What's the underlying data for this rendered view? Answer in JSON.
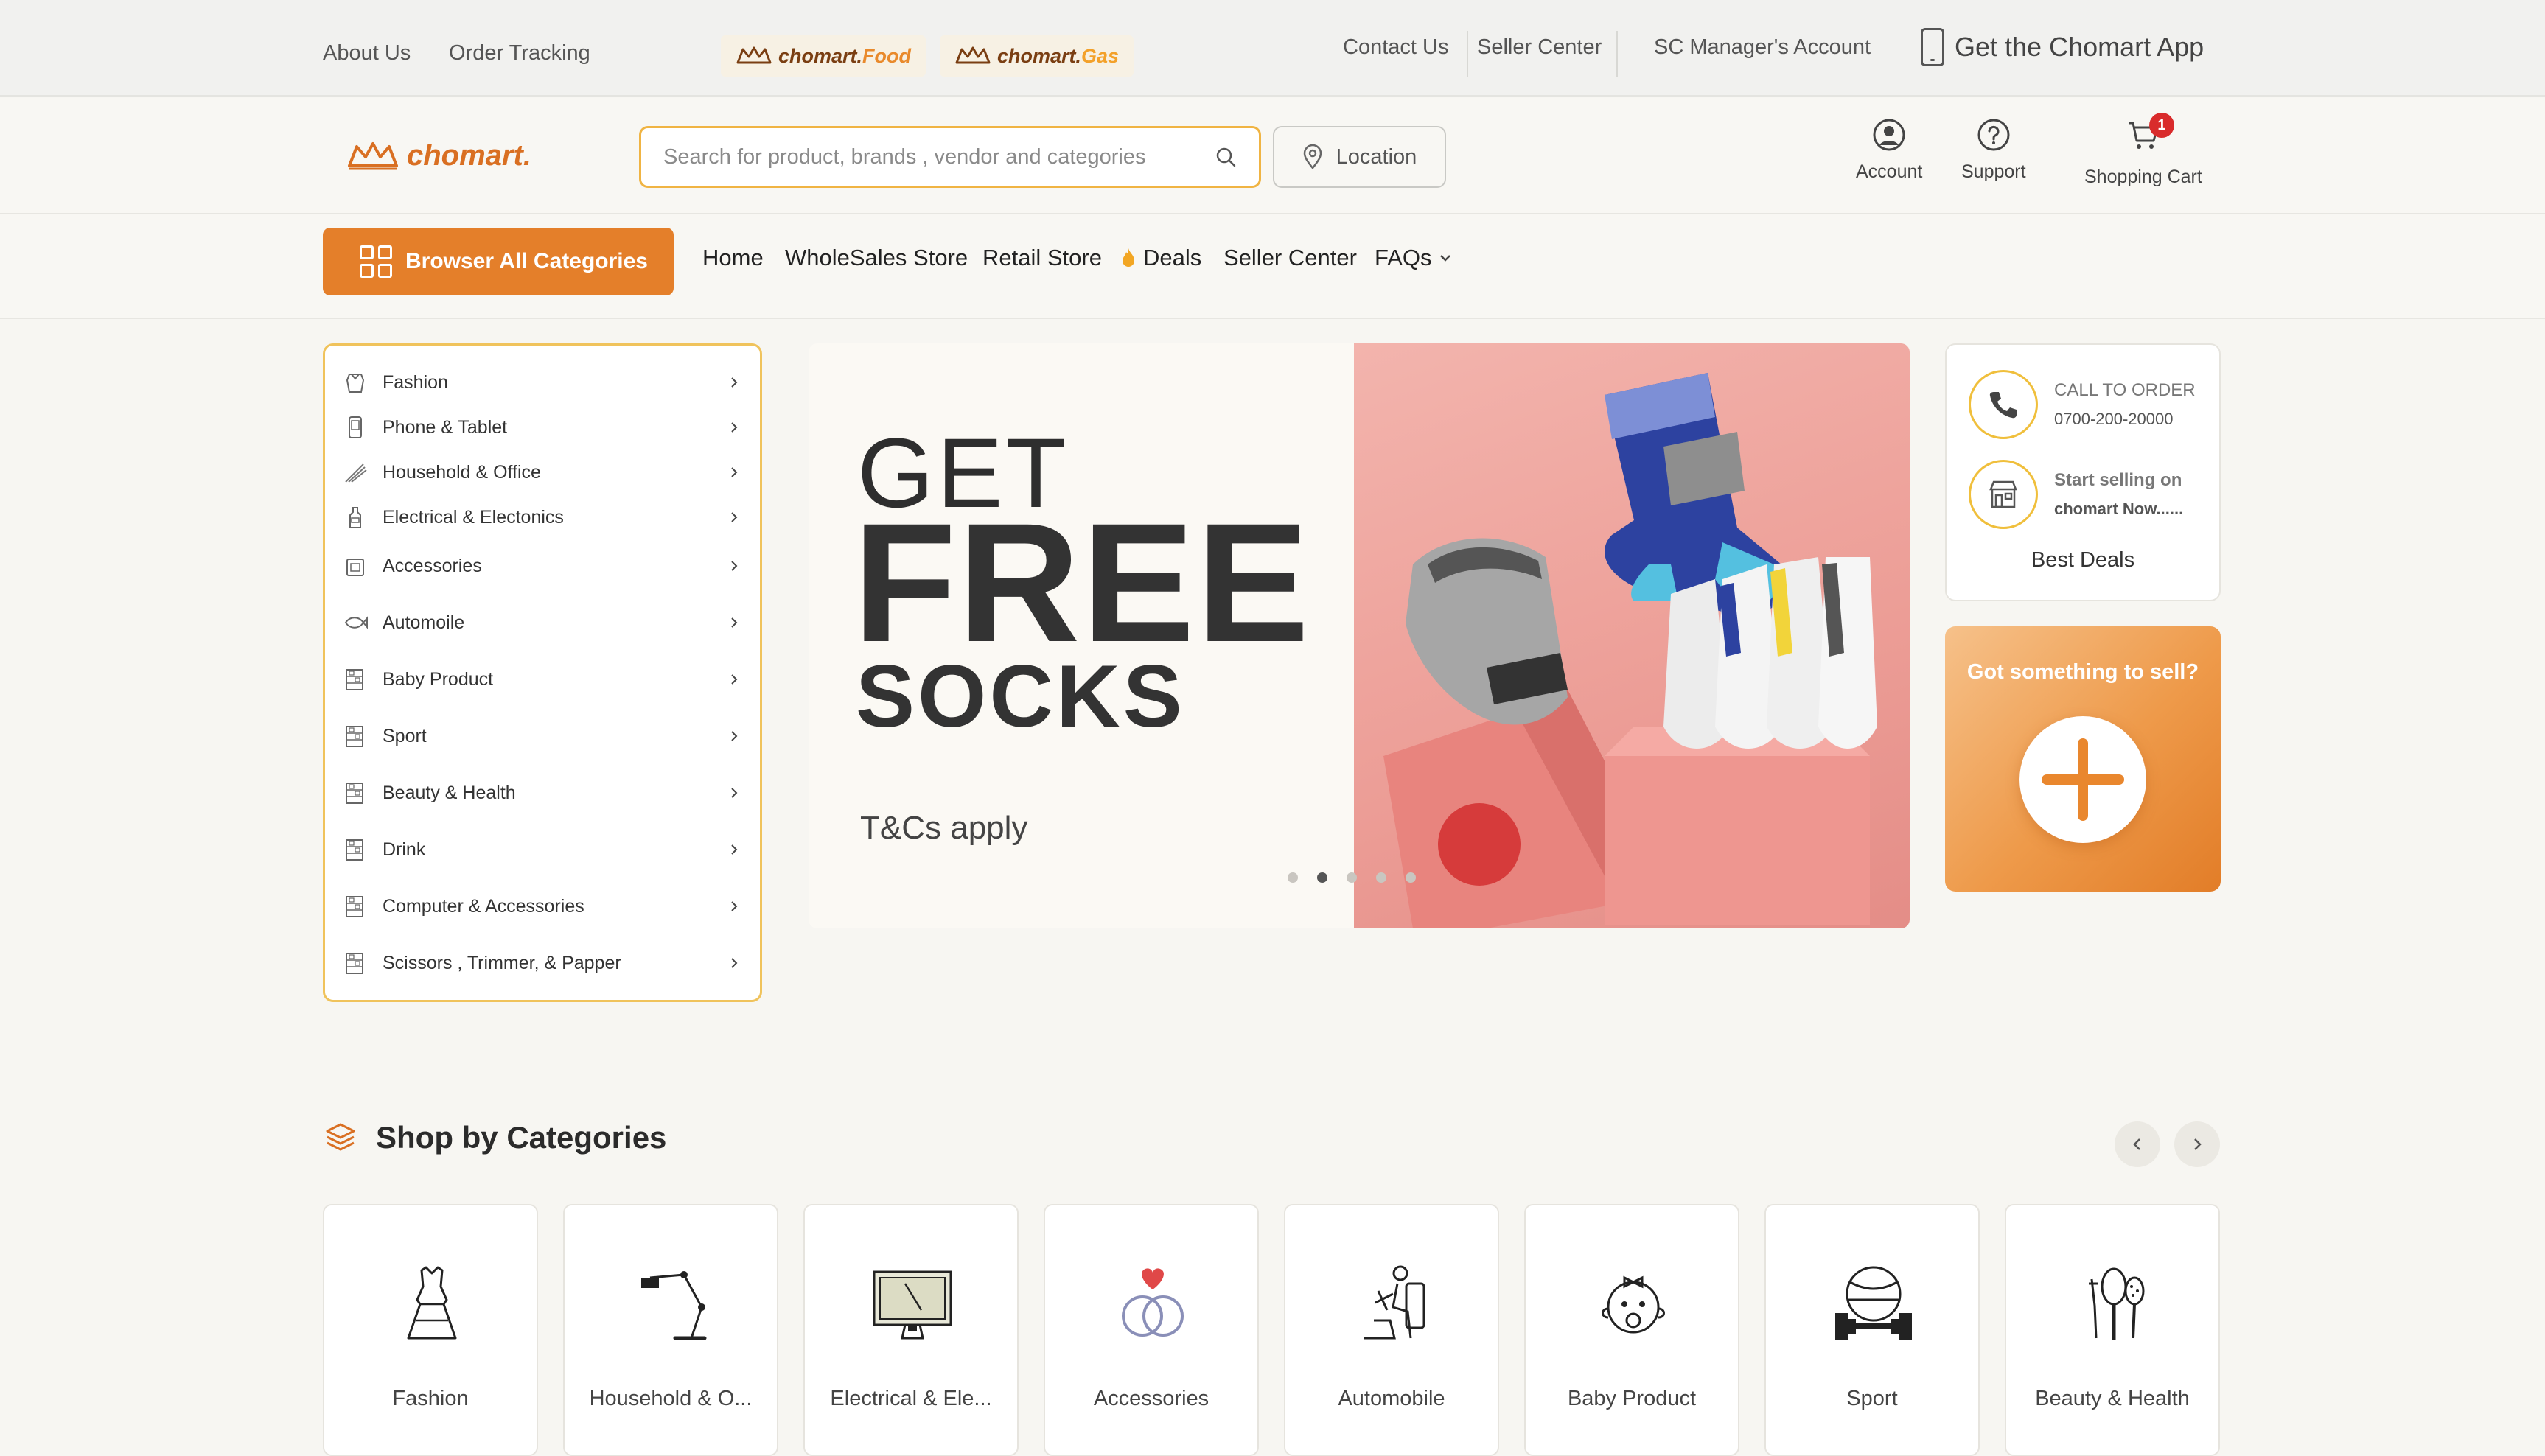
{
  "topbar": {
    "about": "About Us",
    "tracking": "Order Tracking",
    "food_brand": "chomart.",
    "food_suffix": "Food",
    "gas_brand": "chomart.",
    "gas_suffix": "Gas",
    "contact": "Contact Us",
    "seller_center": "Seller Center",
    "manager": "SC Manager's Account",
    "app": "Get the Chomart App"
  },
  "header": {
    "logo": "chomart.",
    "search_placeholder": "Search for product, brands , vendor and categories",
    "location": "Location",
    "account": "Account",
    "support": "Support",
    "cart": "Shopping Cart",
    "cart_count": "1"
  },
  "nav": {
    "browse": "Browser All Categories",
    "home": "Home",
    "wholesale": "WholeSales Store",
    "retail": "Retail Store",
    "deals": "Deals",
    "seller": "Seller Center",
    "faqs": "FAQs"
  },
  "sidebar": {
    "items": [
      {
        "label": "Fashion",
        "icon": "apron-icon"
      },
      {
        "label": "Phone & Tablet",
        "icon": "phone-icon"
      },
      {
        "label": "Household & Office",
        "icon": "broom-icon"
      },
      {
        "label": "Electrical & Electonics",
        "icon": "bottle-icon"
      },
      {
        "label": "Accessories",
        "icon": "box-icon"
      },
      {
        "label": "Automoile",
        "icon": "fish-icon"
      },
      {
        "label": "Baby Product",
        "icon": "shelf-icon"
      },
      {
        "label": "Sport",
        "icon": "shelf-icon"
      },
      {
        "label": "Beauty & Health",
        "icon": "shelf-icon"
      },
      {
        "label": "Drink",
        "icon": "shelf-icon"
      },
      {
        "label": "Computer & Accessories",
        "icon": "shelf-icon"
      },
      {
        "label": "Scissors , Trimmer, & Papper",
        "icon": "shelf-icon"
      }
    ]
  },
  "banner": {
    "get": "GET",
    "free": "FREE",
    "socks": "SOCKS",
    "tcs": "T&Cs apply",
    "slides": 5,
    "active_slide": 2
  },
  "info": {
    "call_title": "CALL TO ORDER",
    "call_number": "0700-200-20000",
    "sell_title": "Start selling on",
    "sell_sub": "chomart Now......",
    "best_deals": "Best Deals"
  },
  "sell_card": {
    "title": "Got something to sell?"
  },
  "categories": {
    "title": "Shop by Categories",
    "items": [
      {
        "label": "Fashion",
        "icon": "dress-icon"
      },
      {
        "label": "Household & O...",
        "icon": "desk-lamp-icon"
      },
      {
        "label": "Electrical & Ele...",
        "icon": "monitor-icon"
      },
      {
        "label": "Accessories",
        "icon": "rings-icon"
      },
      {
        "label": "Automobile",
        "icon": "driver-seat-icon"
      },
      {
        "label": "Baby Product",
        "icon": "baby-icon"
      },
      {
        "label": "Sport",
        "icon": "dumbbell-ball-icon"
      },
      {
        "label": "Beauty & Health",
        "icon": "beauty-tools-icon"
      }
    ]
  },
  "colors": {
    "accent": "#e47f2a",
    "brand_dark": "#7a3e12",
    "highlight": "#f0b443",
    "badge": "#d92b2b"
  }
}
